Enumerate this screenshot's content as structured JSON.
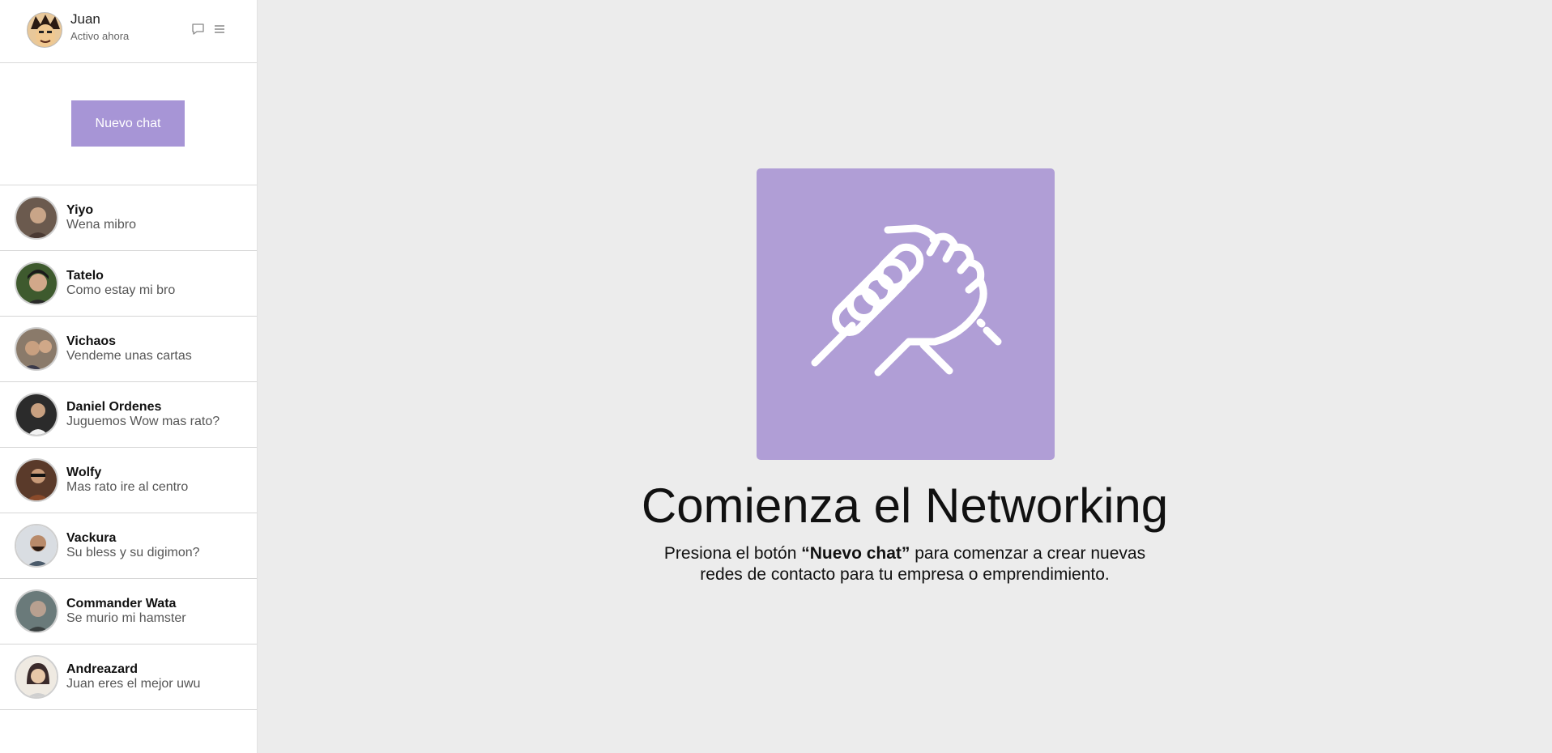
{
  "user": {
    "name": "Juan",
    "status": "Activo ahora"
  },
  "sidebar": {
    "new_chat_label": "Nuevo chat",
    "contacts": [
      {
        "name": "Yiyo",
        "message": "Wena mibro",
        "avatar_color": "#6b5a4e"
      },
      {
        "name": "Tatelo",
        "message": "Como estay mi bro",
        "avatar_color": "#3e5a2e"
      },
      {
        "name": "Vichaos",
        "message": "Vendeme unas cartas",
        "avatar_color": "#8a7a6a"
      },
      {
        "name": "Daniel Ordenes",
        "message": "Juguemos Wow mas rato?",
        "avatar_color": "#2b2b2b"
      },
      {
        "name": "Wolfy",
        "message": "Mas rato ire al centro",
        "avatar_color": "#5a3a2a"
      },
      {
        "name": "Vackura",
        "message": "Su bless y su digimon?",
        "avatar_color": "#4a5a6a"
      },
      {
        "name": "Commander Wata",
        "message": "Se murio mi hamster",
        "avatar_color": "#6a7a7a"
      },
      {
        "name": "Andreazard",
        "message": "Juan eres el mejor uwu",
        "avatar_color": "#3a2a2a"
      }
    ]
  },
  "main": {
    "title": "Comienza el Networking",
    "desc_prefix": "Presiona el botón ",
    "desc_bold": "“Nuevo chat”",
    "desc_line1_suffix": " para comenzar a crear nuevas",
    "desc_line2": "redes de contacto para tu empresa o emprendimiento."
  },
  "colors": {
    "accent": "#a795d6",
    "hero_bg": "#b09ed6",
    "main_bg": "#ececec"
  },
  "icons": {
    "chat": "chat-bubble-icon",
    "menu": "hamburger-menu-icon",
    "hero": "handshake-icon"
  }
}
